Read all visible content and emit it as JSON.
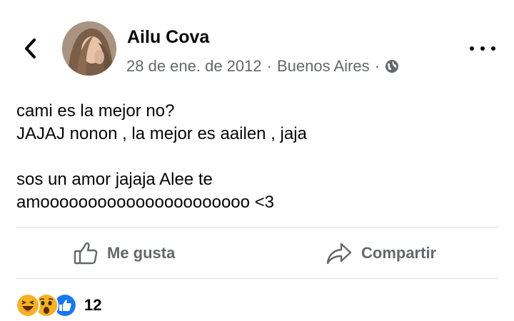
{
  "post": {
    "author": "Ailu Cova",
    "date": "28 de ene. de 2012",
    "location": "Buenos Aires",
    "separator": "·",
    "privacy_icon": "globe-icon",
    "text_lines": [
      "cami es la mejor no?",
      "JAJAJ nonon , la mejor es aailen , jaja",
      "",
      "sos un amor jajaja Alee te",
      "amoooooooooooooooooooooo <3"
    ]
  },
  "actions": {
    "like_label": "Me gusta",
    "share_label": "Compartir"
  },
  "reactions": {
    "icons": [
      "haha-reaction-icon",
      "wow-reaction-icon",
      "like-reaction-icon"
    ],
    "count": "12"
  },
  "colors": {
    "text": "#050505",
    "secondary": "#65676b",
    "like_blue": "#1877f2",
    "reaction_yellow": "#f7b125"
  }
}
